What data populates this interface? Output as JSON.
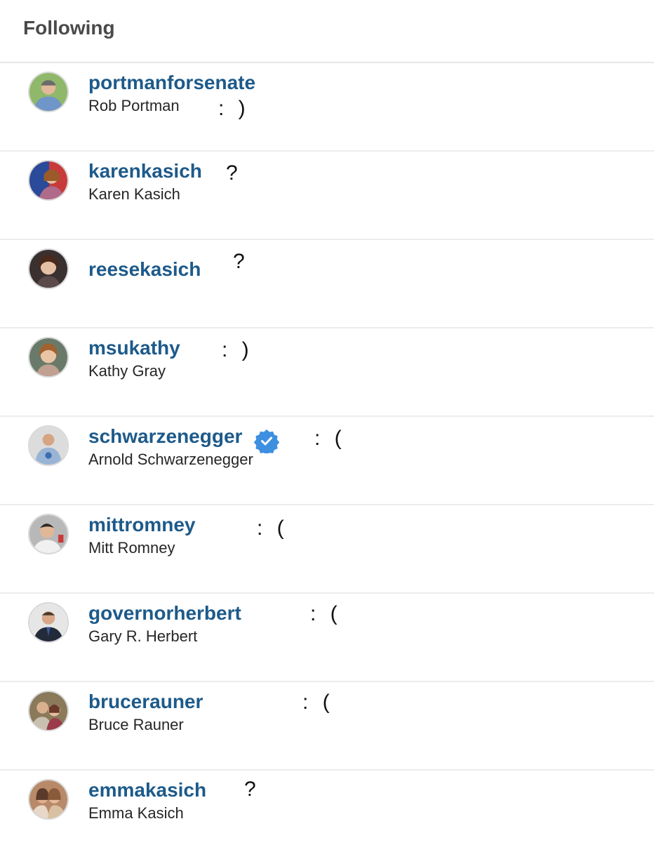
{
  "header": {
    "title": "Following"
  },
  "colors": {
    "username": "#1d5a8a",
    "verified_badge": "#3d8fe0"
  },
  "following": [
    {
      "username": "portmanforsenate",
      "name": "Rob Portman",
      "annotation": ": )",
      "verified": false,
      "avatar_icon": "avatar-photo"
    },
    {
      "username": "karenkasich",
      "name": "Karen Kasich",
      "annotation": "?",
      "verified": false,
      "avatar_icon": "avatar-photo"
    },
    {
      "username": "reesekasich",
      "name": "",
      "annotation": "?",
      "verified": false,
      "avatar_icon": "avatar-photo"
    },
    {
      "username": "msukathy",
      "name": "Kathy Gray",
      "annotation": ": )",
      "verified": false,
      "avatar_icon": "avatar-photo"
    },
    {
      "username": "schwarzenegger",
      "name": "Arnold Schwarzenegger",
      "annotation": ": (",
      "verified": true,
      "avatar_icon": "avatar-photo"
    },
    {
      "username": "mittromney",
      "name": "Mitt Romney",
      "annotation": ": (",
      "verified": false,
      "avatar_icon": "avatar-photo"
    },
    {
      "username": "governorherbert",
      "name": "Gary R. Herbert",
      "annotation": ": (",
      "verified": false,
      "avatar_icon": "avatar-photo"
    },
    {
      "username": "brucerauner",
      "name": "Bruce Rauner",
      "annotation": ": (",
      "verified": false,
      "avatar_icon": "avatar-photo"
    },
    {
      "username": "emmakasich",
      "name": "Emma Kasich",
      "annotation": "?",
      "verified": false,
      "avatar_icon": "avatar-photo"
    }
  ]
}
